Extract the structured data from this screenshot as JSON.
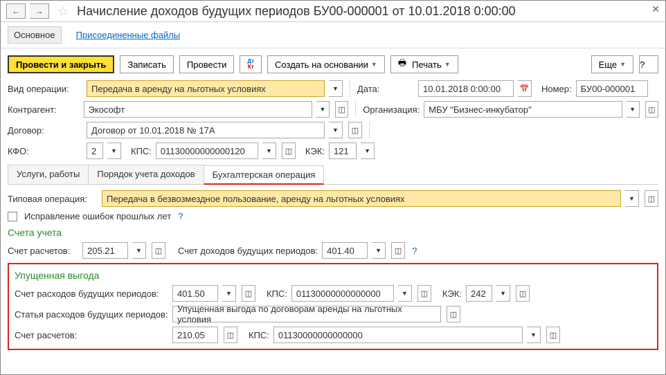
{
  "title": "Начисление доходов будущих периодов БУ00-000001 от 10.01.2018 0:00:00",
  "topTabs": {
    "main": "Основное",
    "files": "Присоединенные файлы"
  },
  "toolbar": {
    "post_close": "Провести и закрыть",
    "save": "Записать",
    "post": "Провести",
    "create_based": "Создать на основании",
    "print": "Печать",
    "more": "Еще"
  },
  "fields": {
    "op_type_label": "Вид операции:",
    "op_type": "Передача в аренду на льготных условиях",
    "date_label": "Дата:",
    "date": "10.01.2018  0:00:00",
    "number_label": "Номер:",
    "number": "БУ00-000001",
    "contragent_label": "Контрагент:",
    "contragent": "Экософт",
    "org_label": "Организация:",
    "org": "МБУ \"Бизнес-инкубатор\"",
    "contract_label": "Договор:",
    "contract": "Договор от 10.01.2018 № 17А",
    "kfo_label": "КФО:",
    "kfo": "2",
    "kps_label": "КПС:",
    "kps": "01130000000000120",
    "kek_label": "КЭК:",
    "kek": "121"
  },
  "subtabs": {
    "t1": "Услуги, работы",
    "t2": "Порядок учета доходов",
    "t3": "Бухгалтерская операция"
  },
  "op": {
    "type_op_label": "Типовая операция:",
    "type_op": "Передача в безвозмездное пользование, аренду на льготных условиях",
    "fix_errors": "Исправление ошибок прошлых лет",
    "accounts_title": "Счета учета",
    "acc_calc_label": "Счет расчетов:",
    "acc_calc": "205.21",
    "acc_future_label": "Счет доходов будущих периодов:",
    "acc_future": "401.40",
    "lost_title": "Упущенная выгода",
    "exp_future_label": "Счет расходов будущих периодов:",
    "exp_future": "401.50",
    "kps2_label": "КПС:",
    "kps2": "01130000000000000",
    "kek2_label": "КЭК:",
    "kek2": "242",
    "article_label": "Статья расходов будущих периодов:",
    "article": "Упущенная выгода по договорам аренды на льготных условия",
    "acc_calc2_label": "Счет расчетов:",
    "acc_calc2": "210.05",
    "kps3_label": "КПС:",
    "kps3": "01130000000000000"
  }
}
